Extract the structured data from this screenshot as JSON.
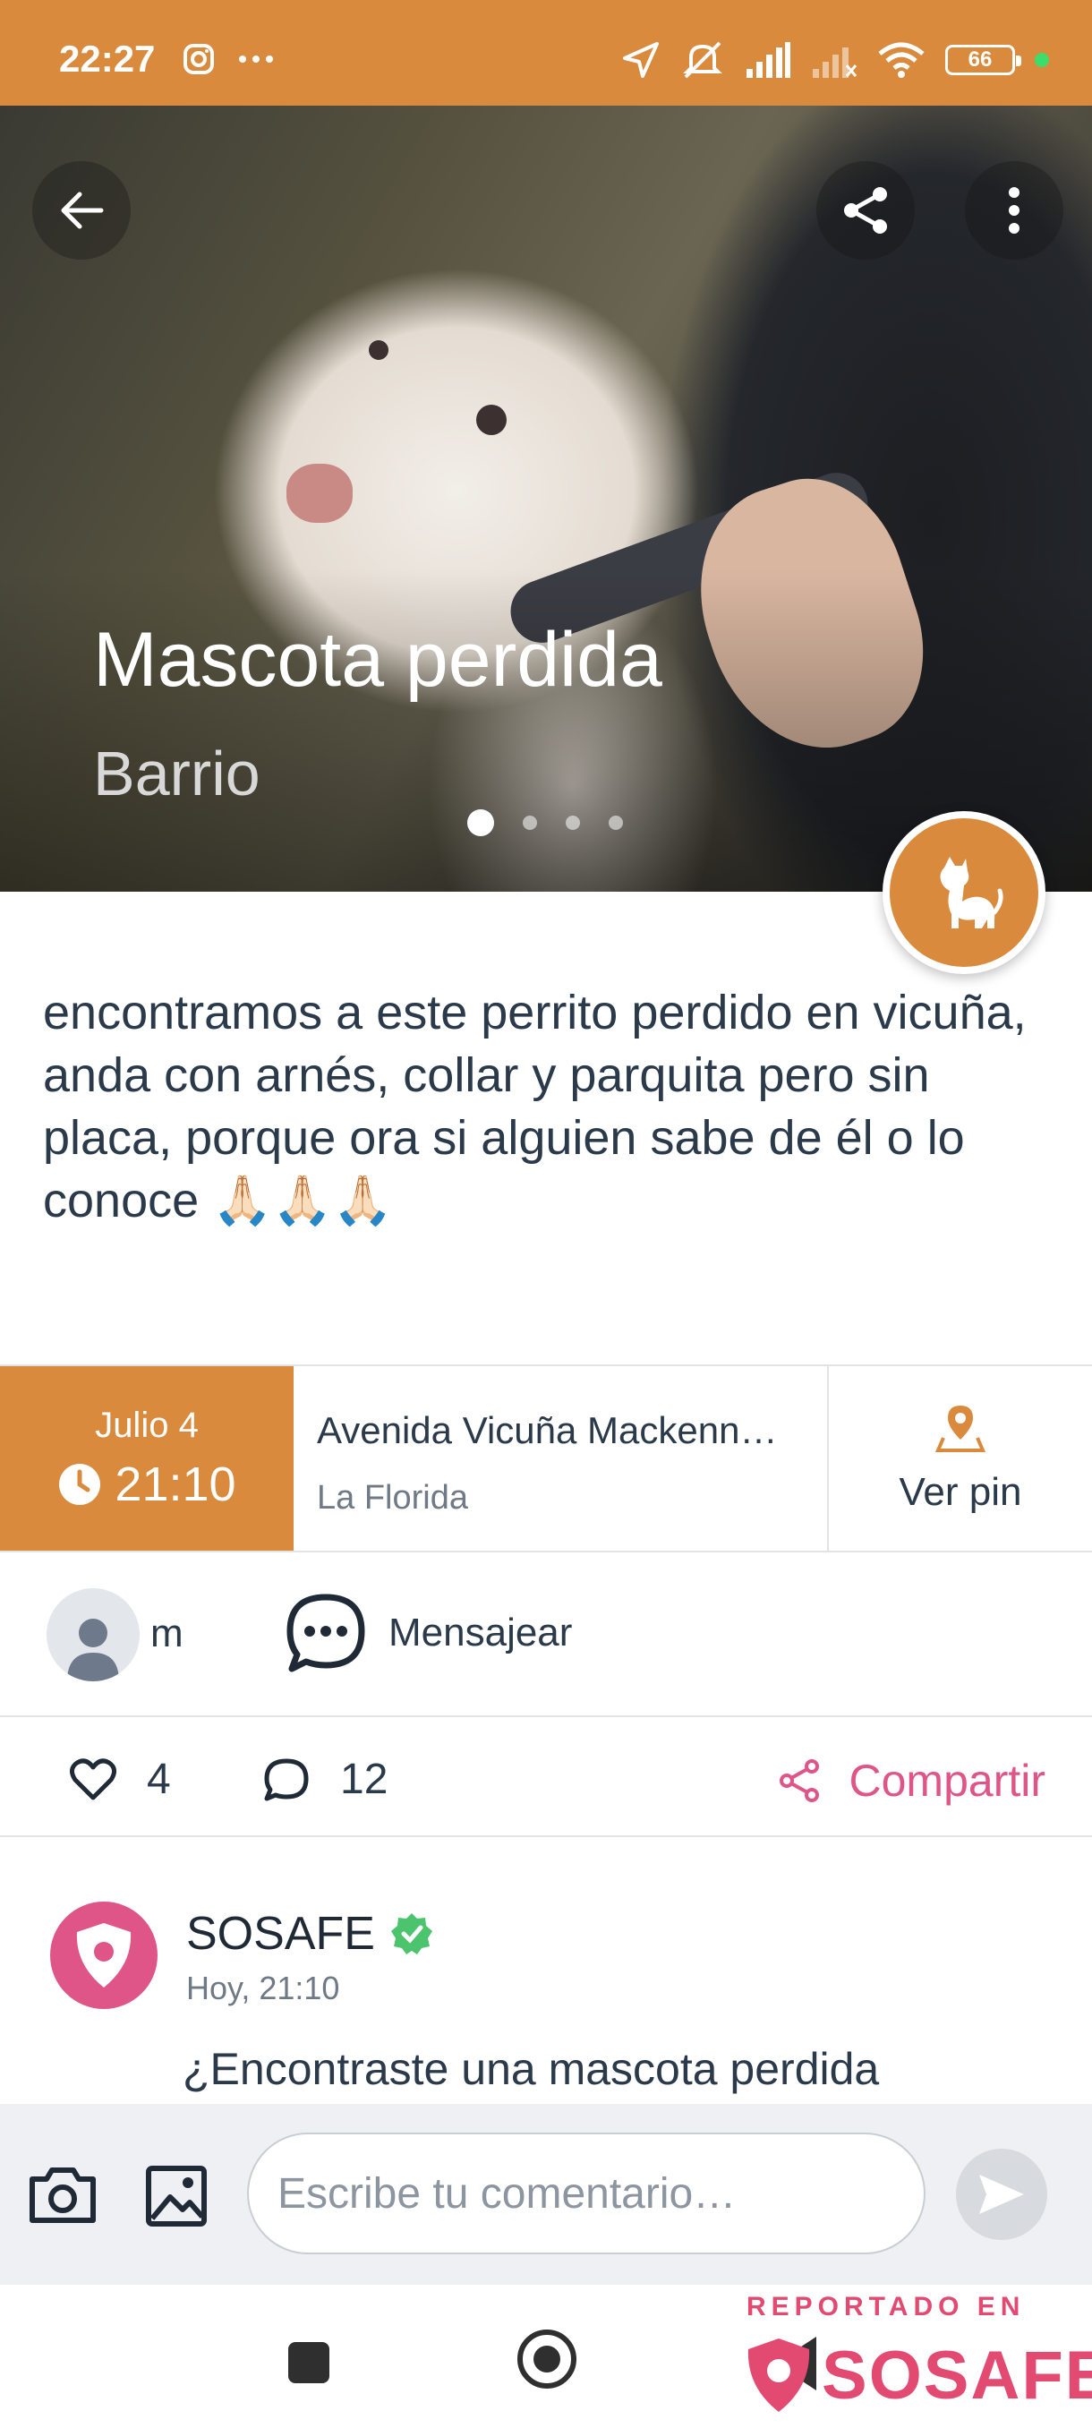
{
  "status_bar": {
    "time": "22:27",
    "battery": "66",
    "icons": [
      "instagram-icon",
      "more-dots-icon",
      "location-arrow-icon",
      "bell-off-icon",
      "signal-icon",
      "signal-icon-2",
      "wifi-icon",
      "battery-icon"
    ]
  },
  "hero": {
    "title": "Mascota perdida",
    "subtitle": "Barrio",
    "image_count": 4,
    "active_image": 1
  },
  "description": "encontramos a este perrito perdido en vicuña, anda con arnés, collar y parquita pero sin placa, porque ora si alguien sabe de él o lo conoce 🙏🏻🙏🏻🙏🏻",
  "info": {
    "date": "Julio 4",
    "time": "21:10",
    "address": "Avenida Vicuña Mackenn…",
    "commune": "La Florida",
    "pin_label": "Ver pin"
  },
  "user": {
    "name": "m",
    "message_label": "Mensajear"
  },
  "actions": {
    "likes": "4",
    "comments": "12",
    "share_label": "Compartir"
  },
  "comment": {
    "author": "SOSAFE",
    "time": "Hoy, 21:10",
    "text": "¿Encontraste una mascota perdida"
  },
  "composer": {
    "placeholder": "Escribe tu comentario…"
  },
  "watermark": {
    "top": "REPORTADO EN",
    "brand": "SOSAFE"
  },
  "colors": {
    "accent": "#d98a3d",
    "brand_pink": "#e05587",
    "text": "#2b3a4a",
    "verified": "#4cc46e"
  }
}
